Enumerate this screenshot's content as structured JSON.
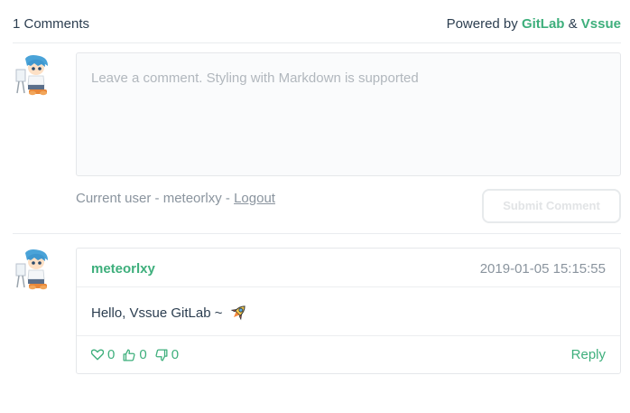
{
  "header": {
    "comment_count_text": "1 Comments",
    "powered_prefix": "Powered by ",
    "powered_gitlab": "GitLab",
    "powered_amp": " & ",
    "powered_vssue": "Vssue"
  },
  "editor": {
    "placeholder": "Leave a comment. Styling with Markdown is supported"
  },
  "status": {
    "current_user_prefix": "Current user - ",
    "username": "meteorlxy",
    "separator": " - ",
    "logout_label": "Logout"
  },
  "submit_label": "Submit Comment",
  "comments": [
    {
      "author": "meteorlxy",
      "timestamp": "2019-01-05 15:15:55",
      "body": "Hello, Vssue GitLab ~",
      "emoji_icon": "rocket-icon",
      "reactions": {
        "heart": "0",
        "thumbs_up": "0",
        "thumbs_down": "0"
      },
      "reply_label": "Reply"
    }
  ],
  "colors": {
    "accent": "#3eaf7c",
    "text": "#2c3e50",
    "muted": "#8a949e",
    "border": "#e5e7ea"
  }
}
